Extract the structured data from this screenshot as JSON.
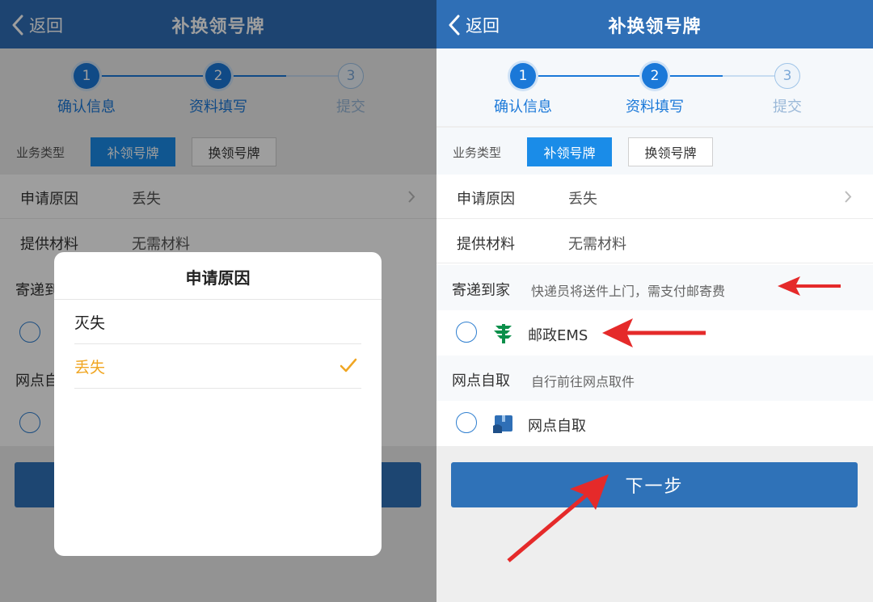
{
  "header": {
    "back_label": "返回",
    "title": "补换领号牌"
  },
  "steps": [
    {
      "number": "1",
      "label": "确认信息",
      "state": "active"
    },
    {
      "number": "2",
      "label": "资料填写",
      "state": "active"
    },
    {
      "number": "3",
      "label": "提交",
      "state": "idle"
    }
  ],
  "business": {
    "label": "业务类型",
    "options": [
      "补领号牌",
      "换领号牌"
    ],
    "selected": "补领号牌"
  },
  "form": {
    "reason": {
      "label": "申请原因",
      "value": "丢失"
    },
    "materials": {
      "label": "提供材料",
      "value": "无需材料"
    }
  },
  "delivery": {
    "home": {
      "title": "寄递到家",
      "desc": "快递员将送件上门，需支付邮寄费",
      "option": "邮政EMS"
    },
    "pickup": {
      "title": "网点自取",
      "desc": "自行前往网点取件",
      "option": "网点自取"
    }
  },
  "next_button": "下一步",
  "dialog": {
    "title": "申请原因",
    "options": [
      {
        "label": "灭失",
        "selected": false
      },
      {
        "label": "丢失",
        "selected": true
      }
    ]
  },
  "colors": {
    "header": "#2f6fb6",
    "accent": "#1a78d8",
    "selected_option": "#f0a623",
    "annotation_arrow": "#e52a2a",
    "ems_green": "#0b8f4a"
  }
}
